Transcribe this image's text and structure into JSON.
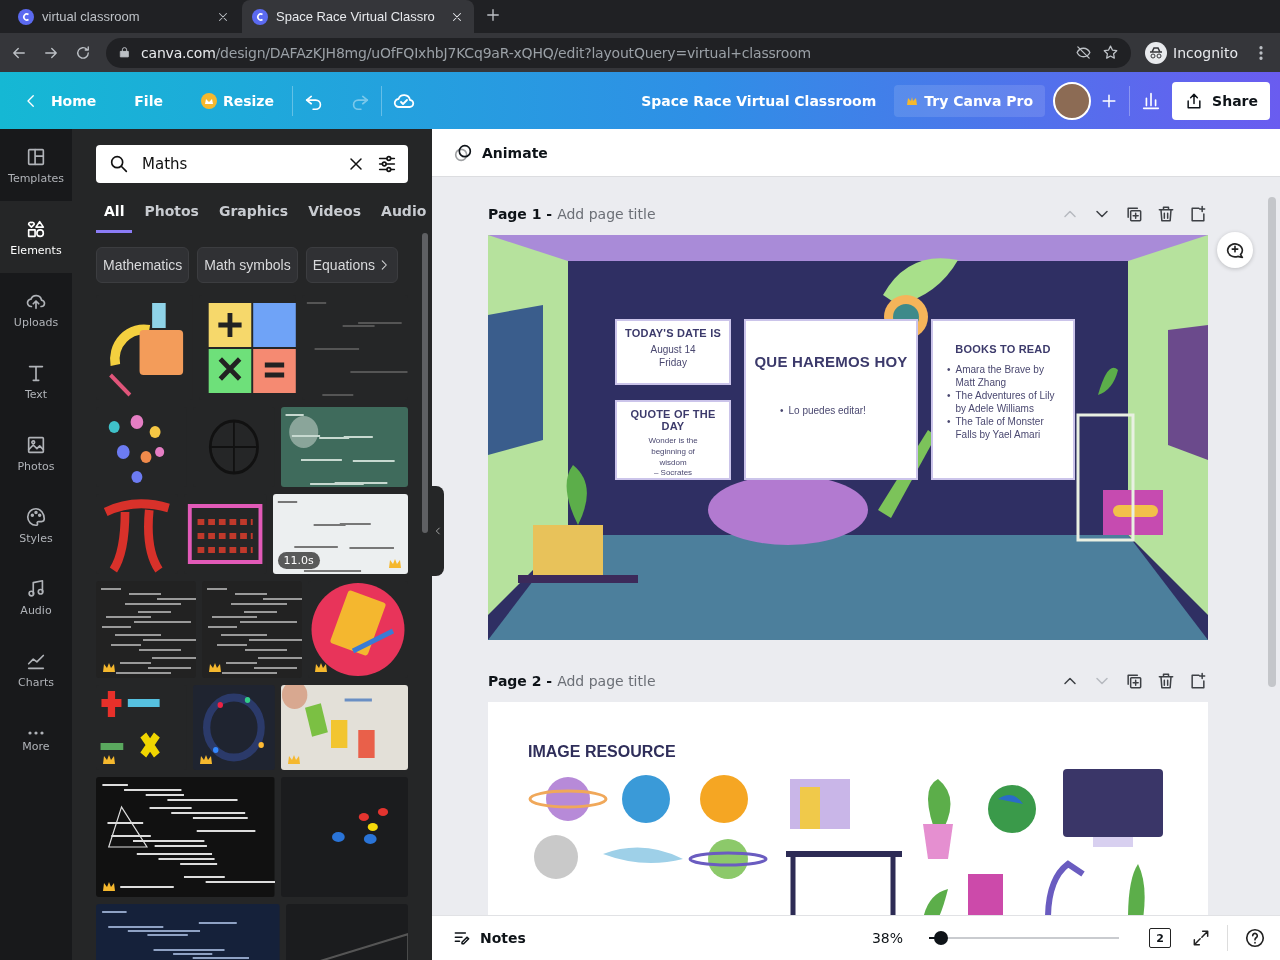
{
  "browser": {
    "tabs": [
      {
        "title": "virtual classroom",
        "selected": false
      },
      {
        "title": "Space Race Virtual Classro",
        "selected": true
      }
    ],
    "url_host": "canva.com",
    "url_path": "/design/DAFAzKJH8mg/uOfFQIxhbJ7KCq9aR-xQHQ/edit?layoutQuery=virtual+classroom",
    "profile": "Incognito"
  },
  "toolbar": {
    "home": "Home",
    "file": "File",
    "resize": "Resize",
    "title": "Space Race Virtual Classroom",
    "pro": "Try Canva Pro",
    "share": "Share"
  },
  "rail": [
    {
      "label": "Templates",
      "selected": false
    },
    {
      "label": "Elements",
      "selected": true
    },
    {
      "label": "Uploads",
      "selected": false
    },
    {
      "label": "Text",
      "selected": false
    },
    {
      "label": "Photos",
      "selected": false
    },
    {
      "label": "Styles",
      "selected": false
    },
    {
      "label": "Audio",
      "selected": false
    },
    {
      "label": "Charts",
      "selected": false
    },
    {
      "label": "More",
      "selected": false
    }
  ],
  "panel": {
    "search": {
      "value": "Maths"
    },
    "tabs": [
      {
        "label": "All",
        "selected": true
      },
      {
        "label": "Photos",
        "selected": false
      },
      {
        "label": "Graphics",
        "selected": false
      },
      {
        "label": "Videos",
        "selected": false
      },
      {
        "label": "Audio",
        "selected": false
      }
    ],
    "chips": [
      "Mathematics",
      "Math symbols",
      "Equations"
    ],
    "results": [
      [
        {
          "kind": "picture",
          "premium": false
        },
        {
          "kind": "picture",
          "premium": false
        },
        {
          "kind": "picture",
          "premium": false
        }
      ],
      [
        {
          "kind": "picture",
          "premium": false
        },
        {
          "kind": "picture",
          "premium": false
        },
        {
          "kind": "picture",
          "premium": false
        }
      ],
      [
        {
          "kind": "picture",
          "premium": false
        },
        {
          "kind": "picture",
          "premium": false
        },
        {
          "kind": "picture",
          "premium": true,
          "duration": "11.0s"
        }
      ],
      [
        {
          "kind": "picture",
          "premium": true
        },
        {
          "kind": "picture",
          "premium": true
        },
        {
          "kind": "picture",
          "premium": true
        }
      ],
      [
        {
          "kind": "picture",
          "premium": true
        },
        {
          "kind": "picture",
          "premium": true
        },
        {
          "kind": "picture",
          "premium": true
        }
      ],
      [
        {
          "kind": "picture",
          "premium": true
        },
        {
          "kind": "picture",
          "premium": false
        }
      ],
      [
        {
          "kind": "picture",
          "premium": false
        },
        {
          "kind": "picture",
          "premium": false
        }
      ]
    ]
  },
  "editor": {
    "animate": "Animate",
    "pages": [
      {
        "label": "Page 1 -",
        "title_placeholder": "Add page title",
        "move_up_disabled": true,
        "move_down_disabled": false,
        "kind": "classroom",
        "cards": [
          {
            "kind": "lines",
            "heading": "TODAY'S DATE IS",
            "lines": [
              "August 14",
              "Friday"
            ]
          },
          {
            "kind": "lines",
            "heading": "QUOTE OF THE DAY",
            "lines": [
              "Wonder is the beginning of wisdom",
              "– Socrates"
            ]
          },
          {
            "kind": "bullets",
            "heading": "QUE HAREMOS HOY",
            "marker": "•",
            "lines": [
              "Lo puedes editar!"
            ]
          },
          {
            "kind": "bullets",
            "heading": "BOOKS TO READ",
            "marker": "•",
            "lines": [
              "Amara the Brave by Matt Zhang",
              "The Adventures of Lily by Adele Williams",
              "The Tale of Monster Falls by Yael Amari"
            ]
          }
        ]
      },
      {
        "label": "Page 2 -",
        "title_placeholder": "Add page title",
        "move_up_disabled": false,
        "move_down_disabled": true,
        "kind": "resources",
        "heading": "IMAGE RESOURCE"
      }
    ],
    "notes": "Notes",
    "zoom": "38%",
    "zoom_slider": {
      "level": 0.03
    },
    "page_count": "2"
  }
}
